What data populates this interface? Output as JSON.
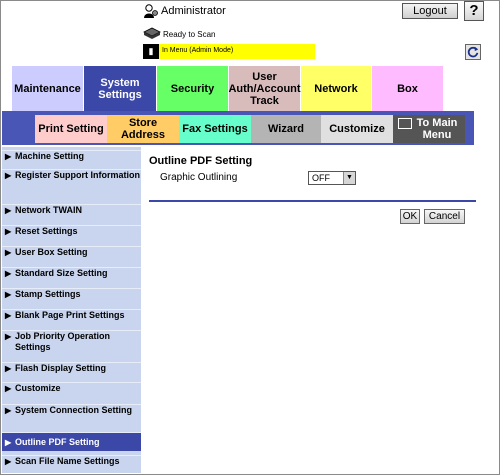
{
  "header": {
    "user_label": "Administrator",
    "logout_label": "Logout",
    "help_label": "?",
    "status_text": "Ready to Scan",
    "mode_text": "In Menu (Admin Mode)"
  },
  "main_tabs": [
    {
      "label": "Maintenance",
      "color": "#ccccff"
    },
    {
      "label": "System Settings",
      "color": "#3b48a8",
      "selected": true
    },
    {
      "label": "Security",
      "color": "#66ff66"
    },
    {
      "label": "User Auth/Account Track",
      "color": "#d8bcbc"
    },
    {
      "label": "Network",
      "color": "#ffff66"
    },
    {
      "label": "Box",
      "color": "#ffbbff"
    }
  ],
  "sub_tabs": [
    {
      "label": "Print Setting",
      "color": "#ffcccc"
    },
    {
      "label": "Store Address",
      "color": "#ffcc66"
    },
    {
      "label": "Fax Settings",
      "color": "#66ffcc"
    },
    {
      "label": "Wizard",
      "color": "#b4b4b4"
    },
    {
      "label": "Customize",
      "color": "#e0e0e0"
    },
    {
      "label": "To Main Menu",
      "color": "#555555",
      "icon": "menu-icon"
    }
  ],
  "sidebar": {
    "items": [
      {
        "label": "Machine Setting"
      },
      {
        "label": "Register Support Information"
      },
      {
        "label": "Network TWAIN"
      },
      {
        "label": "Reset Settings"
      },
      {
        "label": "User Box Setting"
      },
      {
        "label": "Standard Size Setting"
      },
      {
        "label": "Stamp Settings"
      },
      {
        "label": "Blank Page Print Settings"
      },
      {
        "label": "Job Priority Operation Settings"
      },
      {
        "label": "Flash Display Setting"
      },
      {
        "label": "Customize"
      },
      {
        "label": "System Connection Setting"
      },
      {
        "label": "Outline PDF Setting",
        "selected": true
      },
      {
        "label": "Scan File Name Settings"
      }
    ]
  },
  "content": {
    "title": "Outline PDF Setting",
    "field_label": "Graphic Outlining",
    "field_value": "OFF",
    "ok_label": "OK",
    "cancel_label": "Cancel"
  },
  "colors": {
    "accent": "#3b48a8",
    "sidebar_bg": "#c9d5ee",
    "mode_bar": "#ffff00"
  }
}
